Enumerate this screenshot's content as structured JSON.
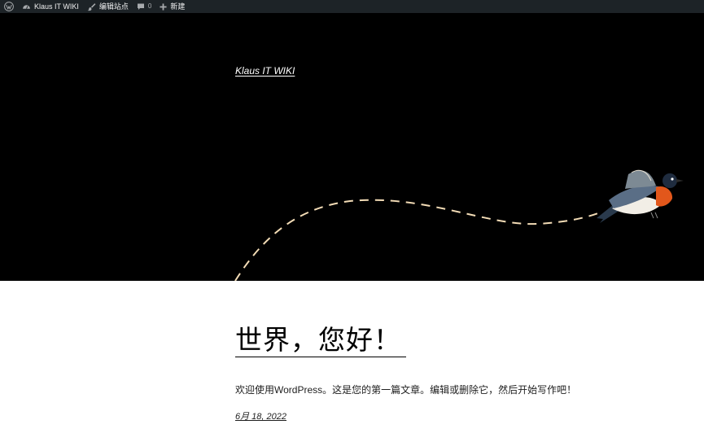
{
  "admin_bar": {
    "site_name": "Klaus IT WIKI",
    "customize_label": "编辑站点",
    "comments_count": "0",
    "new_label": "新建"
  },
  "header": {
    "site_title": "Klaus IT WIKI"
  },
  "post": {
    "title": "世界，您好！",
    "excerpt": "欢迎使用WordPress。这是您的第一篇文章。编辑或删除它，然后开始写作吧！",
    "date": "6月 18, 2022"
  },
  "colors": {
    "admin_bar_bg": "#1d2327",
    "header_bg": "#000000",
    "dash_line": "#f3dcb6",
    "bird_breast": "#e2571b"
  },
  "icons": [
    "wordpress-logo-icon",
    "dashboard-gauge-icon",
    "brush-icon",
    "comment-bubble-icon",
    "plus-icon",
    "bird-illustration"
  ]
}
